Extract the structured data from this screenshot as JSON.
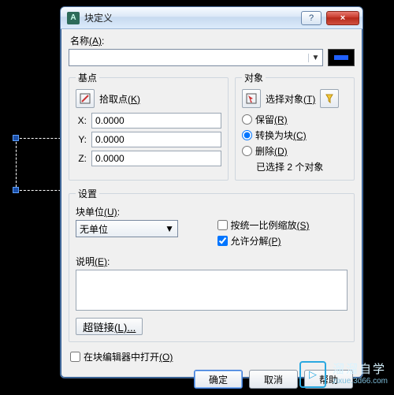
{
  "window": {
    "title": "块定义",
    "help_glyph": "?",
    "close_glyph": "×",
    "app_icon_text": "A"
  },
  "name": {
    "label": "名称",
    "shortcut": "(A)",
    "value": ""
  },
  "preview": {
    "color": "#2060ff"
  },
  "base": {
    "legend": "基点",
    "pick_label": "拾取点",
    "pick_shortcut": "(K)",
    "x_label": "X:",
    "x_value": "0.0000",
    "y_label": "Y:",
    "y_value": "0.0000",
    "z_label": "Z:",
    "z_value": "0.0000"
  },
  "objects": {
    "legend": "对象",
    "select_label": "选择对象",
    "select_shortcut": "(T)",
    "filter_icon": "filter-icon",
    "opt_retain": "保留",
    "opt_retain_sc": "(R)",
    "opt_convert": "转换为块",
    "opt_convert_sc": "(C)",
    "opt_delete": "删除",
    "opt_delete_sc": "(D)",
    "selected_option": "convert",
    "status": "已选择 2 个对象"
  },
  "settings": {
    "legend": "设置",
    "unit_label": "块单位",
    "unit_sc": "(U)",
    "unit_value": "无单位",
    "scale_label": "按统一比例缩放",
    "scale_sc": "(S)",
    "scale_checked": false,
    "explode_label": "允许分解",
    "explode_sc": "(P)",
    "explode_checked": true,
    "desc_label": "说明",
    "desc_sc": "(E)",
    "desc_value": "",
    "hyperlink_label": "超链接",
    "hyperlink_sc": "(L)..."
  },
  "open_editor": {
    "label": "在块编辑器中打开",
    "sc": "(O)",
    "checked": false
  },
  "buttons": {
    "ok": "确定",
    "cancel": "取消",
    "help": "帮助"
  },
  "watermark": {
    "cn": "溜溜自学",
    "en": "zixue.3d66.com",
    "play": "▷"
  }
}
